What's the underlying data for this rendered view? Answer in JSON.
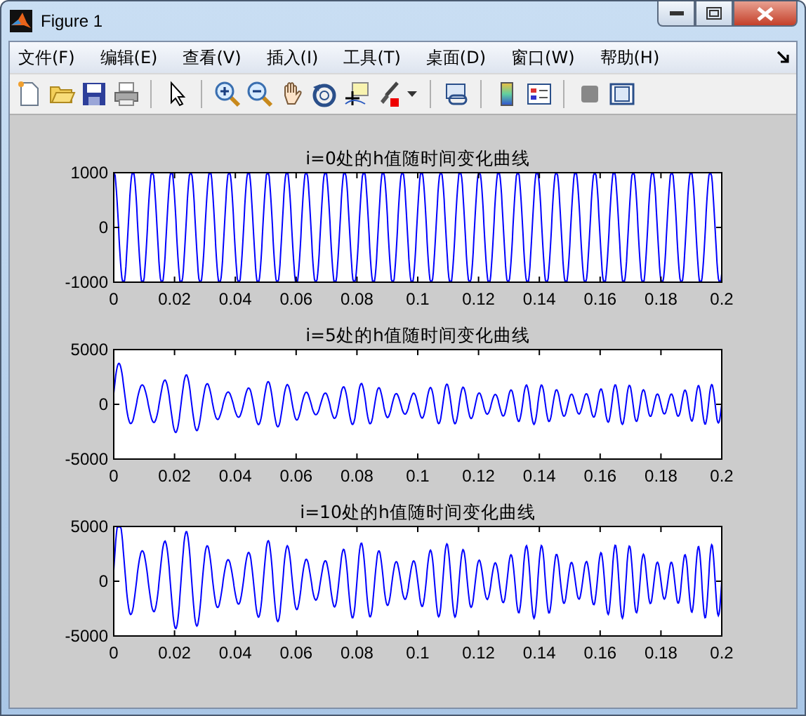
{
  "window": {
    "title": "Figure 1"
  },
  "menu": [
    "文件(F)",
    "编辑(E)",
    "查看(V)",
    "插入(I)",
    "工具(T)",
    "桌面(D)",
    "窗口(W)",
    "帮助(H)"
  ],
  "plots": [
    {
      "title": "i=0处的h值随时间变化曲线",
      "yticks": [
        "1000",
        "0",
        "-1000"
      ],
      "xticks": [
        "0",
        "0.02",
        "0.04",
        "0.06",
        "0.08",
        "0.1",
        "0.12",
        "0.14",
        "0.16",
        "0.18",
        "0.2"
      ]
    },
    {
      "title": "i=5处的h值随时间变化曲线",
      "yticks": [
        "5000",
        "0",
        "-5000"
      ],
      "xticks": [
        "0",
        "0.02",
        "0.04",
        "0.06",
        "0.08",
        "0.1",
        "0.12",
        "0.14",
        "0.16",
        "0.18",
        "0.2"
      ]
    },
    {
      "title": "i=10处的h值随时间变化曲线",
      "yticks": [
        "5000",
        "0",
        "-5000"
      ],
      "xticks": [
        "0",
        "0.02",
        "0.04",
        "0.06",
        "0.08",
        "0.1",
        "0.12",
        "0.14",
        "0.16",
        "0.18",
        "0.2"
      ]
    }
  ]
}
